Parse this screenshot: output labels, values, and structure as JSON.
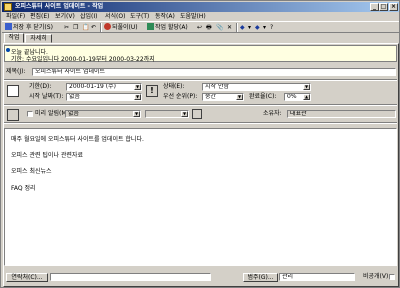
{
  "window": {
    "title": "오피스튜터 사이트 업데이트 - 작업"
  },
  "menu": [
    "파일(F)",
    "편집(E)",
    "보기(V)",
    "삽입(I)",
    "서식(O)",
    "도구(T)",
    "동작(A)",
    "도움말(H)"
  ],
  "toolbar": {
    "save_close": "저장 후 닫기(S)",
    "recurrence": "되풀이(U)",
    "assign": "작업 할당(A)",
    "reply_arrow": "▾"
  },
  "tabs": [
    "작업",
    "자세히"
  ],
  "info": {
    "line1": "오늘 끝납니다.",
    "line2": "기한: 수요일입니다 2000-01-19부터 2000-03-22까지"
  },
  "form": {
    "subject_label": "제목(J):",
    "subject_value": "오피스튜터 사이트 업데이트",
    "due_label": "기한(D):",
    "due_value": "2000-01-19 (수)",
    "start_label": "시작 날짜(T):",
    "start_value": "없음",
    "status_label": "상태(E):",
    "status_value": "시작 안함",
    "priority_label": "우선 순위(P):",
    "priority_value": "중간",
    "percent_label": "완료율(C):",
    "percent_value": "0%",
    "reminder_label": "미리 알림(M):",
    "reminder_value": "없음",
    "owner_label": "소유자:",
    "owner_value": "대표관"
  },
  "body_lines": [
    "매주 월요일에 오피스튜터 사이트를 업데이트 합니다.",
    "오피스 관련 팁이나 관련자료",
    "오피스 최신뉴스",
    "FAQ 정리"
  ],
  "footer": {
    "contacts_button": "연락처(C)...",
    "categories_button": "범주(G)...",
    "categories_value": "관리",
    "private_label": "비공개(V)"
  }
}
